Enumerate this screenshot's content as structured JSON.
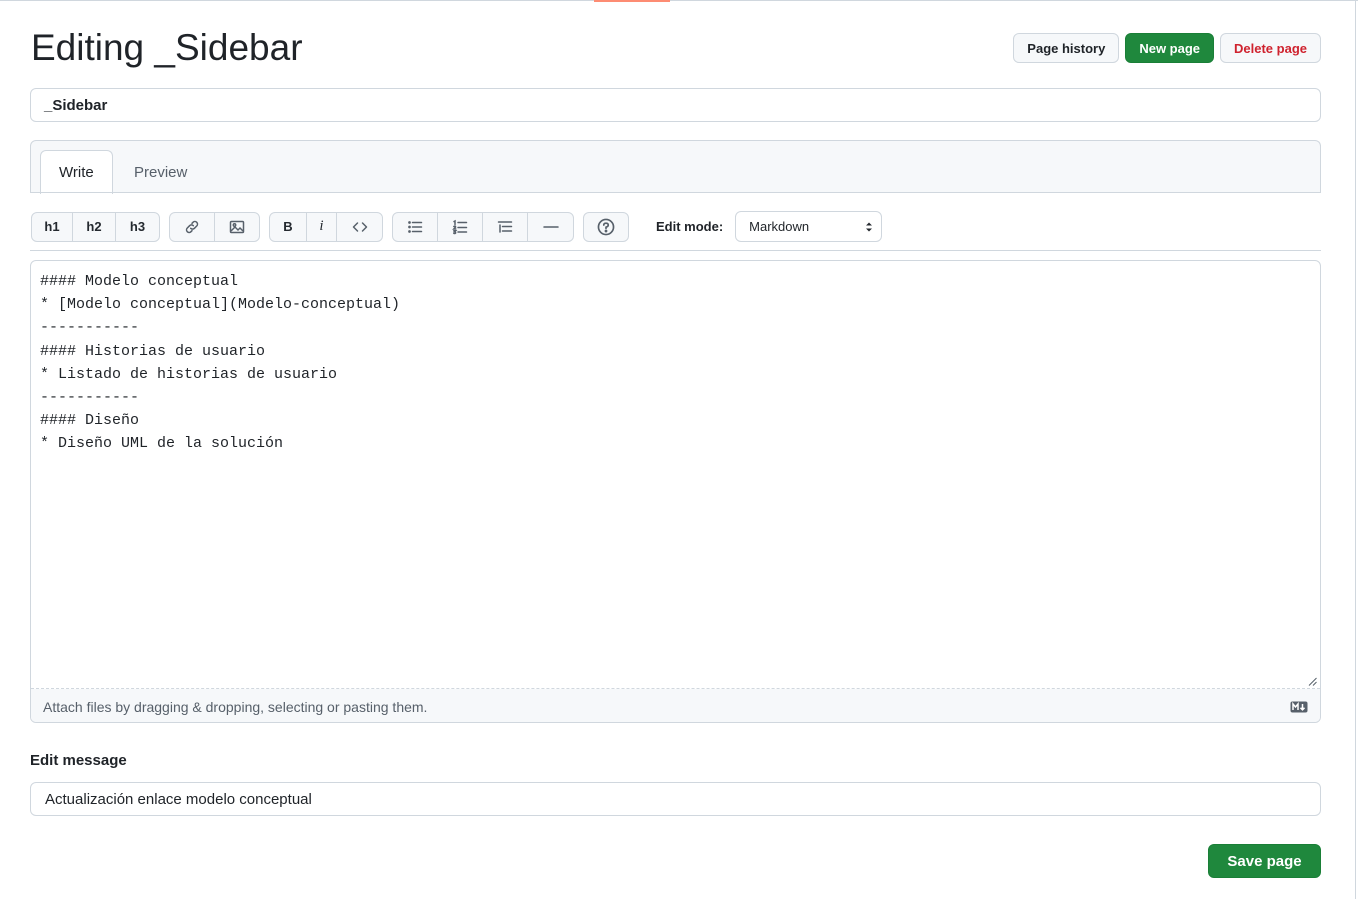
{
  "page": {
    "title": "Editing _Sidebar"
  },
  "header_actions": {
    "page_history": "Page history",
    "new_page": "New page",
    "delete_page": "Delete page"
  },
  "title_field": {
    "value": "_Sidebar"
  },
  "tabs": {
    "write": "Write",
    "preview": "Preview"
  },
  "toolbar": {
    "h1": "h1",
    "h2": "h2",
    "h3": "h3",
    "bold": "B",
    "italic": "i",
    "icons": [
      "link-icon",
      "image-icon",
      "code-icon",
      "unordered-list-icon",
      "ordered-list-icon",
      "task-list-icon",
      "horizontal-rule-icon",
      "help-icon"
    ],
    "edit_mode_label": "Edit mode:",
    "edit_mode_value": "Markdown"
  },
  "editor": {
    "content": "#### Modelo conceptual\n* [Modelo conceptual](Modelo-conceptual)\n-----------\n#### Historias de usuario\n* Listado de historias de usuario\n-----------\n#### Diseño\n* Diseño UML de la solución",
    "attach_hint": "Attach files by dragging & dropping, selecting or pasting them."
  },
  "edit_message": {
    "label": "Edit message",
    "value": "Actualización enlace modelo conceptual"
  },
  "footer": {
    "save_page": "Save page"
  },
  "colors": {
    "primary": "#1f883d",
    "danger": "#cf222e",
    "border": "#d0d7de",
    "subtle_bg": "#f6f8fa",
    "accent_top": "#fd8c73"
  }
}
